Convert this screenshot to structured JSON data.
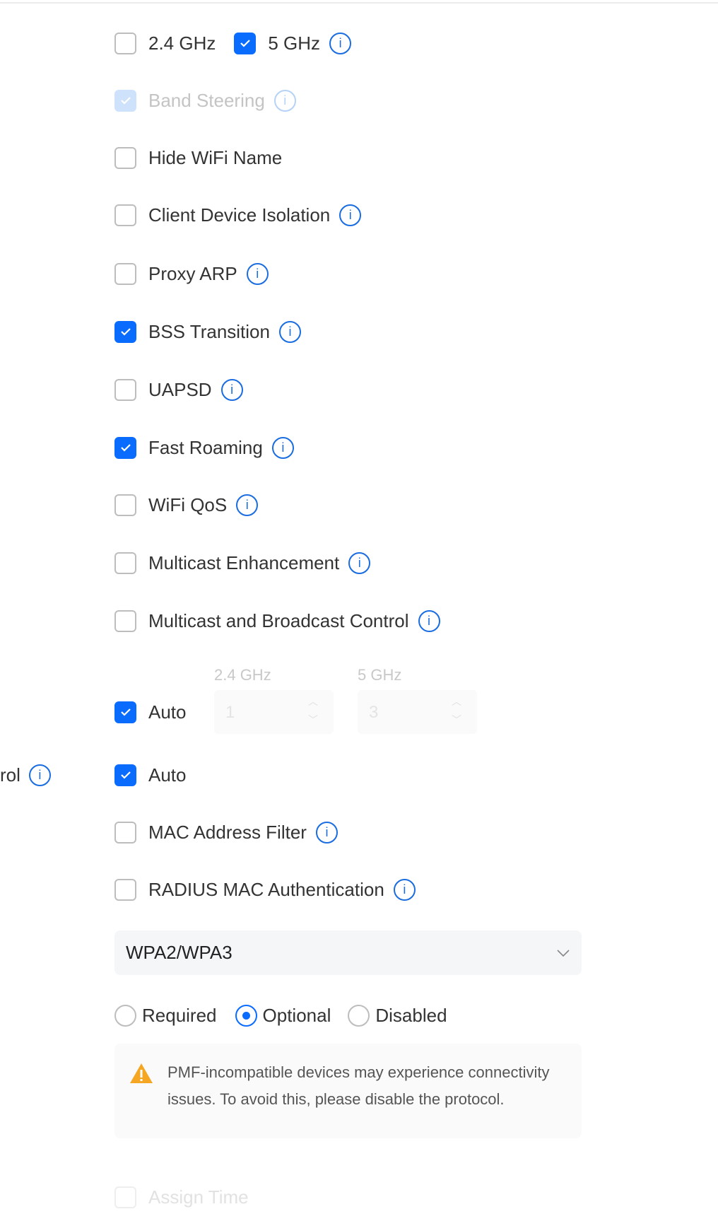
{
  "bands": {
    "b24": {
      "label": "2.4 GHz",
      "checked": false
    },
    "b5": {
      "label": "5 GHz",
      "checked": true
    }
  },
  "options": [
    {
      "label": "Band Steering",
      "checked": true,
      "disabled": true,
      "info": true
    },
    {
      "label": "Hide WiFi Name",
      "checked": false,
      "info": false
    },
    {
      "label": "Client Device Isolation",
      "checked": false,
      "info": true
    },
    {
      "label": "Proxy ARP",
      "checked": false,
      "info": true
    },
    {
      "label": "BSS Transition",
      "checked": true,
      "info": true
    },
    {
      "label": "UAPSD",
      "checked": false,
      "info": true
    },
    {
      "label": "Fast Roaming",
      "checked": true,
      "info": true
    },
    {
      "label": "WiFi QoS",
      "checked": false,
      "info": true
    },
    {
      "label": "Multicast Enhancement",
      "checked": false,
      "info": true
    },
    {
      "label": "Multicast and Broadcast Control",
      "checked": false,
      "info": true
    }
  ],
  "channel": {
    "auto_label": "Auto",
    "auto_checked": true,
    "b24_label": "2.4 GHz",
    "b24_value": "1",
    "b5_label": "5 GHz",
    "b5_value": "3"
  },
  "side_label": "rol",
  "power": {
    "auto_label": "Auto",
    "auto_checked": true
  },
  "mac_filter": {
    "label": "MAC Address Filter",
    "checked": false
  },
  "radius": {
    "label": "RADIUS MAC Authentication",
    "checked": false
  },
  "security": {
    "value": "WPA2/WPA3"
  },
  "pmf": {
    "options": [
      "Required",
      "Optional",
      "Disabled"
    ],
    "selected": "Optional"
  },
  "warning": {
    "text": "PMF-incompatible devices may experience connectivity issues. To avoid this, please disable the protocol.",
    "color": "#f5a623"
  },
  "assign_time": {
    "label": "Assign Time",
    "checked": false,
    "disabled": true
  },
  "colors": {
    "accent": "#0a6cff",
    "info": "#1a6de0"
  }
}
